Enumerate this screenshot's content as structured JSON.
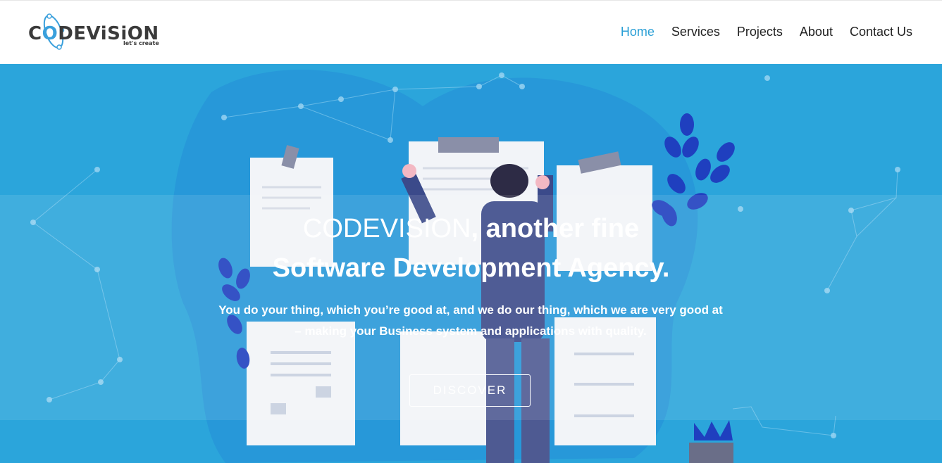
{
  "brand": {
    "name_prefix": "C",
    "name_o": "O",
    "name_rest": "DEViSiON",
    "tagline": "let's create"
  },
  "nav": {
    "items": [
      {
        "label": "Home",
        "active": true
      },
      {
        "label": "Services",
        "active": false
      },
      {
        "label": "Projects",
        "active": false
      },
      {
        "label": "About",
        "active": false
      },
      {
        "label": "Contact Us",
        "active": false
      }
    ]
  },
  "hero": {
    "title_line1_light": "CODEVISION",
    "title_line1_bold": ", another fine",
    "title_line2": "Software Development Agency.",
    "subtitle_line1": "You do your thing, which you’re good at, and we do our thing, which we are very good at",
    "subtitle_line2": "– making your Business system and applications with quality.",
    "cta": "DISCOVER"
  },
  "colors": {
    "accent": "#2a9fd6",
    "hero_bg": "#2ba5db",
    "text_dark": "#222222"
  }
}
